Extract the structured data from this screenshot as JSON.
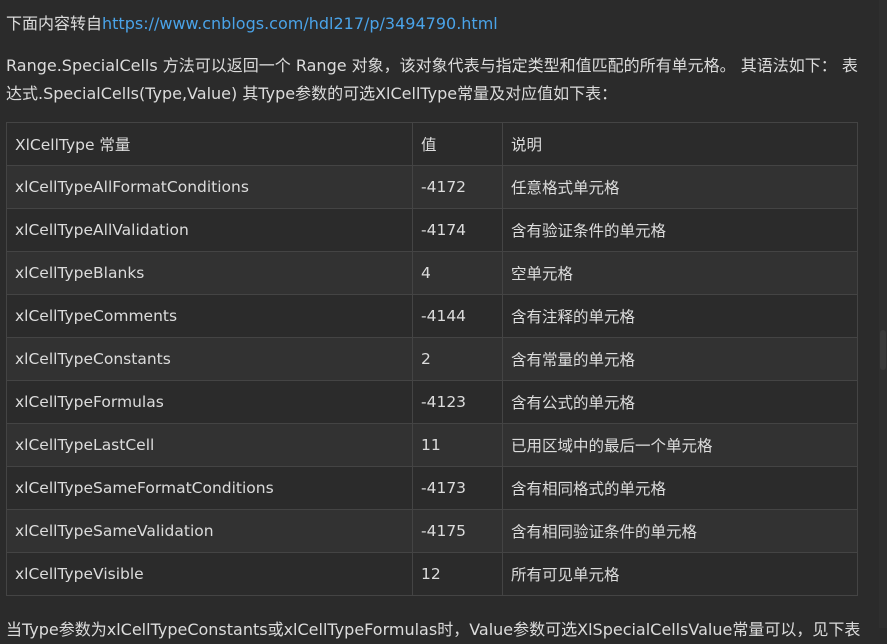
{
  "source": {
    "prefix": "下面内容转自",
    "link": "https://www.cnblogs.com/hdl217/p/3494790.html"
  },
  "intro": "Range.SpecialCells 方法可以返回一个 Range 对象，该对象代表与指定类型和值匹配的所有单元格。 其语法如下： 表达式.SpecialCells(Type,Value) 其Type参数的可选XlCellType常量及对应值如下表：",
  "table": {
    "headers": [
      "XlCellType 常量",
      "值",
      "说明"
    ],
    "rows": [
      [
        "xlCellTypeAllFormatConditions",
        "-4172",
        "任意格式单元格"
      ],
      [
        "xlCellTypeAllValidation",
        "-4174",
        "含有验证条件的单元格"
      ],
      [
        "xlCellTypeBlanks",
        "4",
        "空单元格"
      ],
      [
        "xlCellTypeComments",
        "-4144",
        "含有注释的单元格"
      ],
      [
        "xlCellTypeConstants",
        "2",
        "含有常量的单元格"
      ],
      [
        "xlCellTypeFormulas",
        "-4123",
        "含有公式的单元格"
      ],
      [
        "xlCellTypeLastCell",
        "11",
        "已用区域中的最后一个单元格"
      ],
      [
        "xlCellTypeSameFormatConditions",
        "-4173",
        "含有相同格式的单元格"
      ],
      [
        "xlCellTypeSameValidation",
        "-4175",
        "含有相同验证条件的单元格"
      ],
      [
        "xlCellTypeVisible",
        "12",
        "所有可见单元格"
      ]
    ]
  },
  "footer": "当Type参数为xlCellTypeConstants或xlCellTypeFormulas时，Value参数可选XlSpecialCellsValue常量可以，见下表"
}
